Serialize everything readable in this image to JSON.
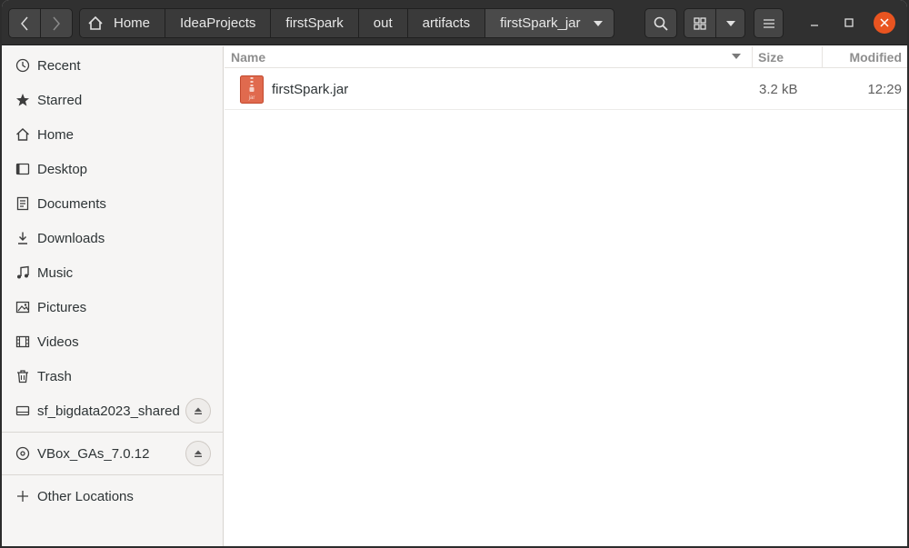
{
  "breadcrumbs": [
    {
      "label": "Home"
    },
    {
      "label": "IdeaProjects"
    },
    {
      "label": "firstSpark"
    },
    {
      "label": "out"
    },
    {
      "label": "artifacts"
    },
    {
      "label": "firstSpark_jar"
    }
  ],
  "sidebar": {
    "items": [
      {
        "label": "Recent",
        "icon": "clock-icon"
      },
      {
        "label": "Starred",
        "icon": "star-icon"
      },
      {
        "label": "Home",
        "icon": "home-icon"
      },
      {
        "label": "Desktop",
        "icon": "desktop-icon"
      },
      {
        "label": "Documents",
        "icon": "document-icon"
      },
      {
        "label": "Downloads",
        "icon": "download-icon"
      },
      {
        "label": "Music",
        "icon": "music-icon"
      },
      {
        "label": "Pictures",
        "icon": "picture-icon"
      },
      {
        "label": "Videos",
        "icon": "video-icon"
      },
      {
        "label": "Trash",
        "icon": "trash-icon"
      }
    ],
    "mounts": [
      {
        "label": "sf_bigdata2023_shared",
        "icon": "drive-icon"
      },
      {
        "label": "VBox_GAs_7.0.12",
        "icon": "optical-disc-icon"
      }
    ],
    "other_locations": {
      "label": "Other Locations",
      "icon": "plus-icon"
    }
  },
  "columns": {
    "name": "Name",
    "size": "Size",
    "modified": "Modified"
  },
  "files": [
    {
      "name": "firstSpark.jar",
      "size": "3.2 kB",
      "modified": "12:29",
      "icon_label": "jar",
      "icon": "archive-icon"
    }
  ],
  "colors": {
    "accent": "#e95420",
    "header": "#303030",
    "sidebar": "#f6f5f4"
  }
}
